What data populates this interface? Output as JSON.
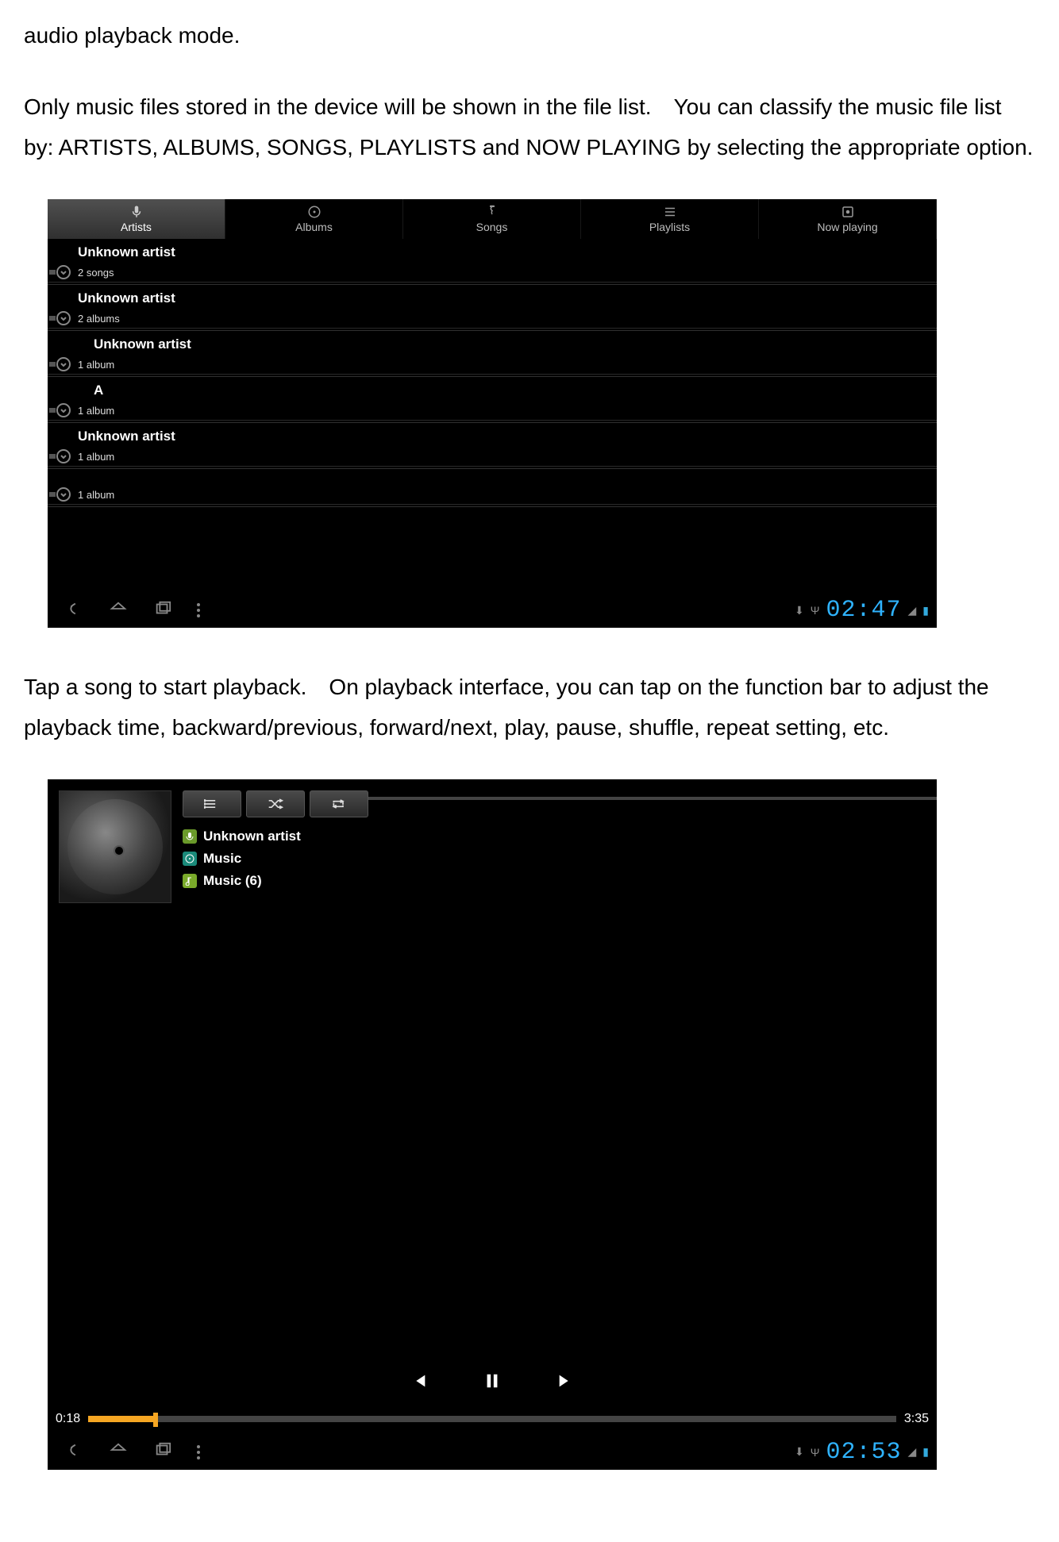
{
  "doc": {
    "p1": "audio playback mode.",
    "p2": "Only music files stored in the device will be shown in the file list. You can classify the music file list by: ARTISTS, ALBUMS, SONGS, PLAYLISTS and NOW PLAYING by selecting the appropriate option.",
    "p3": "Tap a song to start playback. On playback interface, you can tap on the function bar to adjust the playback time, backward/previous, forward/next, play, pause, shuffle, repeat setting, etc."
  },
  "s1": {
    "tabs": [
      {
        "label": "Artists",
        "icon": "mic-icon",
        "selected": true
      },
      {
        "label": "Albums",
        "icon": "disc-icon",
        "selected": false
      },
      {
        "label": "Songs",
        "icon": "note-icon",
        "selected": false
      },
      {
        "label": "Playlists",
        "icon": "list-icon",
        "selected": false
      },
      {
        "label": "Now playing",
        "icon": "disc2-icon",
        "selected": false
      }
    ],
    "groups": [
      {
        "title": "Unknown artist",
        "sub": "2 songs"
      },
      {
        "title": "Unknown artist",
        "sub": "2 albums"
      },
      {
        "title": "Unknown artist",
        "sub": "1 album"
      },
      {
        "title": "A",
        "sub": "1 album"
      },
      {
        "title": "Unknown artist",
        "sub": "1 album"
      },
      {
        "title": "",
        "sub": "1 album"
      }
    ],
    "clock": "02:47"
  },
  "s2": {
    "artist": "Unknown artist",
    "album": "Music",
    "track": "Music (6)",
    "elapsed": "0:18",
    "total": "3:35",
    "progress_pct": 8,
    "clock": "02:53"
  }
}
